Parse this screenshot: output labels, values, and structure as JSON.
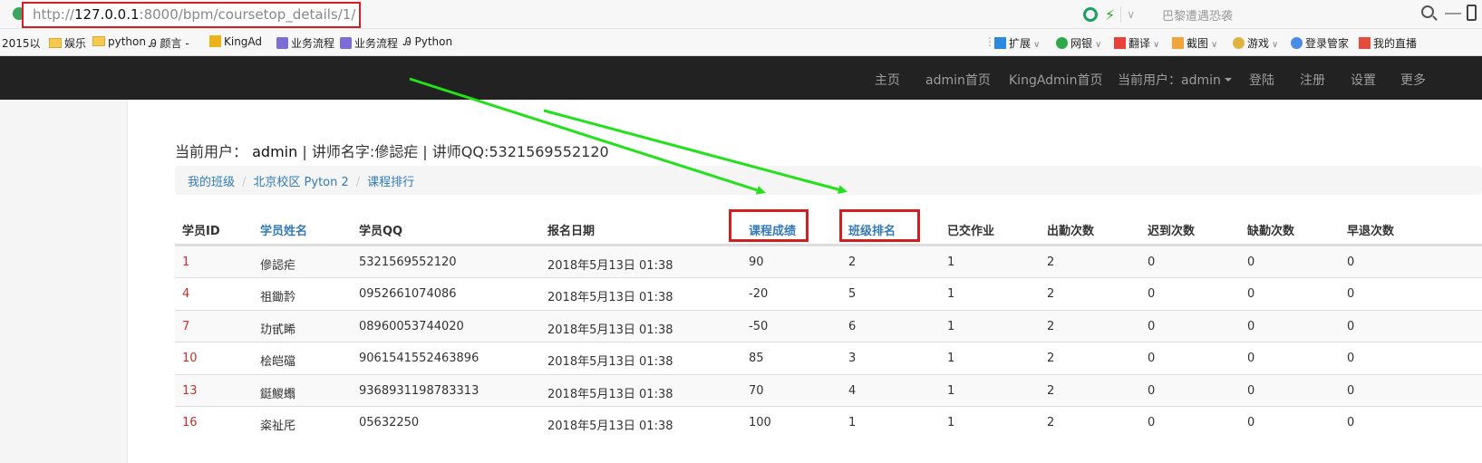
{
  "browser": {
    "url_host": "127.0.0.1",
    "url_rest": ":8000/bpm/coursetop_details/1/",
    "url_prefix": "http://",
    "search_text": "巴黎遭遇恐袭",
    "bookmarks_left": [
      "2015以",
      "娱乐",
      "python",
      "颜言 -",
      "KingAd",
      "业务流程",
      "业务流程",
      "Python"
    ],
    "bookmarks_right": [
      "扩展",
      "网银",
      "翻译",
      "截图",
      "游戏",
      "登录管家",
      "我的直播"
    ]
  },
  "navbar": {
    "items": [
      "主页",
      "admin首页",
      "KingAdmin首页",
      "当前用户：admin",
      "登陆",
      "注册",
      "设置",
      "更多"
    ]
  },
  "header": {
    "user_prefix": "当前用户：",
    "user_name": "admin",
    "teacher_info": " | 讲师名字:傪誋疟 | 讲师QQ:5321569552120"
  },
  "breadcrumb": {
    "items": [
      "我的班级",
      "北京校区 Pyton 2",
      "课程排行"
    ],
    "separator": "/"
  },
  "table": {
    "columns": [
      "学员ID",
      "学员姓名",
      "学员QQ",
      "报名日期",
      "课程成绩",
      "班级排名",
      "已交作业",
      "出勤次数",
      "迟到次数",
      "缺勤次数",
      "早退次数"
    ],
    "rows": [
      [
        "1",
        "傪誋疟",
        "5321569552120",
        "2018年5月13日 01:38",
        "90",
        "2",
        "1",
        "2",
        "0",
        "0",
        "0"
      ],
      [
        "4",
        "祖鋤霒",
        "0952661074086",
        "2018年5月13日 01:38",
        "-20",
        "5",
        "1",
        "2",
        "0",
        "0",
        "0"
      ],
      [
        "7",
        "玏甙睎",
        "08960053744020",
        "2018年5月13日 01:38",
        "-50",
        "6",
        "1",
        "2",
        "0",
        "0",
        "0"
      ],
      [
        "10",
        "桧皑礑",
        "9061541552463896",
        "2018年5月13日 01:38",
        "85",
        "3",
        "1",
        "2",
        "0",
        "0",
        "0"
      ],
      [
        "13",
        "鋌鯼蠮",
        "9368931198783313",
        "2018年5月13日 01:38",
        "70",
        "4",
        "1",
        "2",
        "0",
        "0",
        "0"
      ],
      [
        "16",
        "粢祉厇",
        "05632250",
        "2018年5月13日 01:38",
        "100",
        "1",
        "1",
        "2",
        "0",
        "0",
        "0"
      ]
    ]
  },
  "colors": {
    "navbar_bg": "#222222",
    "link": "#337ab7",
    "id_link": "#c9302c",
    "highlight_box": "#d21f1f",
    "arrow": "#22e01a"
  }
}
